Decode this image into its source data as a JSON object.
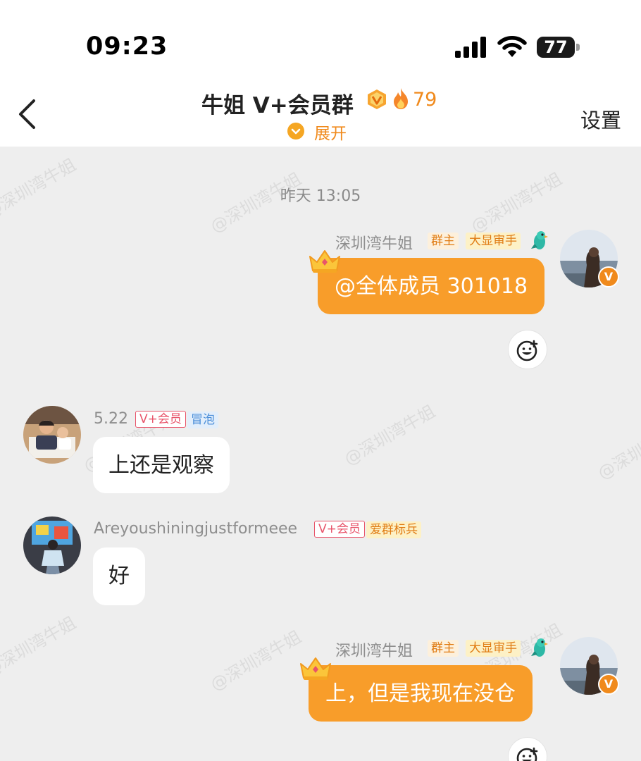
{
  "status_bar": {
    "time": "09:23",
    "battery": "77"
  },
  "header": {
    "title": "牛姐 V+会员群",
    "fire_count": "79",
    "expand_label": "展开",
    "settings_label": "设置"
  },
  "chat": {
    "watermark": "@深圳湾牛姐",
    "timestamp": "昨天 13:05",
    "messages": [
      {
        "sender": "深圳湾牛姐",
        "tags": [
          "群主",
          "大显审手"
        ],
        "text": "@全体成员 301018",
        "is_self": true
      },
      {
        "sender": "5.22",
        "tags": [
          "V+会员",
          "冒泡"
        ],
        "text": "上还是观察",
        "is_self": false
      },
      {
        "sender": "Areyoushiningjustformeee",
        "tags": [
          "V+会员",
          "爱群标兵"
        ],
        "text": "好",
        "is_self": false
      },
      {
        "sender": "深圳湾牛姐",
        "tags": [
          "群主",
          "大显审手"
        ],
        "text": "上，但是我现在没仓",
        "is_self": true
      }
    ]
  },
  "colors": {
    "accent": "#f89d2a",
    "chat_bg": "#eeeeee",
    "orange_text": "#f08a1c"
  }
}
